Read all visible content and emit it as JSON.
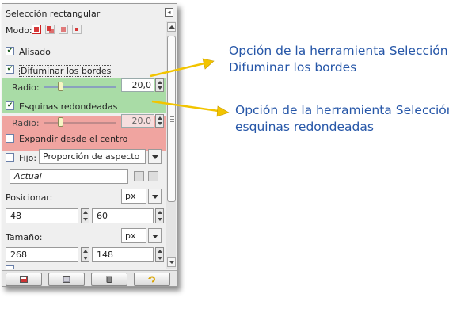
{
  "panel": {
    "title": "Selección rectangular",
    "mode_label": "Modo:",
    "smooth": {
      "label": "Alisado",
      "checked": true
    },
    "feather": {
      "label": "Difuminar los bordes",
      "checked": true,
      "radius_label": "Radio:",
      "radius_value": "20,0",
      "slider_fraction": 0.2
    },
    "rounded": {
      "label": "Esquinas redondeadas",
      "checked": true,
      "radius_label": "Radio:",
      "radius_value": "20,0",
      "slider_fraction": 0.2
    },
    "expand": {
      "label": "Expandir desde el centro",
      "checked": false
    },
    "fixed": {
      "label": "Fijo:",
      "checked": false,
      "option": "Proporción de aspecto",
      "value": "Actual"
    },
    "position": {
      "label": "Posicionar:",
      "unit": "px",
      "x": "48",
      "y": "60"
    },
    "size": {
      "label": "Tamaño:",
      "unit": "px",
      "w": "268",
      "h": "148"
    },
    "toolbar": {
      "icons": [
        "save-icon",
        "restore-icon",
        "delete-icon",
        "reset-icon"
      ]
    }
  },
  "annotations": {
    "feather_note": {
      "line1": "Opción de la herramienta Selección",
      "line2": "Difuminar los bordes"
    },
    "rounded_note": {
      "line1": "Opción de la herramienta Selección",
      "line2": "esquinas redondeadas"
    },
    "arrow_color": "#f2c400",
    "text_color": "#2757a8"
  },
  "colors": {
    "feather_highlight": "#a9dca6",
    "rounded_highlight": "#f0a4a0"
  }
}
